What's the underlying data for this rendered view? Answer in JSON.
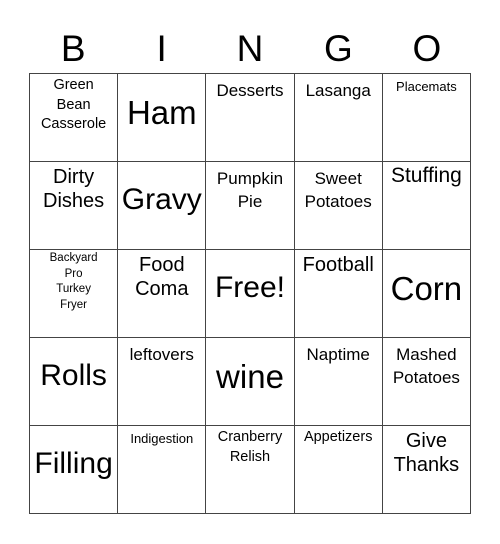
{
  "header": [
    "B",
    "I",
    "N",
    "G",
    "O"
  ],
  "cells": [
    {
      "text": "Green\nBean\nCasserole",
      "size": "s14"
    },
    {
      "text": "Ham",
      "size": "s33"
    },
    {
      "text": "Desserts",
      "size": "s17"
    },
    {
      "text": "Lasanga",
      "size": "s17"
    },
    {
      "text": "Placemats",
      "size": "s13"
    },
    {
      "text": "Dirty\nDishes",
      "size": "s20"
    },
    {
      "text": "Gravy",
      "size": "s30"
    },
    {
      "text": "Pumpkin\nPie",
      "size": "s17"
    },
    {
      "text": "Sweet\nPotatoes",
      "size": "s17"
    },
    {
      "text": "Stuffing",
      "size": "s22"
    },
    {
      "text": "Backyard\nPro\nTurkey\nFryer",
      "size": "s11"
    },
    {
      "text": "Food\nComa",
      "size": "s20"
    },
    {
      "text": "Free!",
      "size": "s30"
    },
    {
      "text": "Football",
      "size": "s20"
    },
    {
      "text": "Corn",
      "size": "s33"
    },
    {
      "text": "Rolls",
      "size": "s30"
    },
    {
      "text": "leftovers",
      "size": "s17"
    },
    {
      "text": "wine",
      "size": "s33"
    },
    {
      "text": "Naptime",
      "size": "s17"
    },
    {
      "text": "Mashed\nPotatoes",
      "size": "s17"
    },
    {
      "text": "Filling",
      "size": "s30"
    },
    {
      "text": "Indigestion",
      "size": "s13"
    },
    {
      "text": "Cranberry\nRelish",
      "size": "s14"
    },
    {
      "text": "Appetizers",
      "size": "s14"
    },
    {
      "text": "Give\nThanks",
      "size": "s20"
    }
  ]
}
